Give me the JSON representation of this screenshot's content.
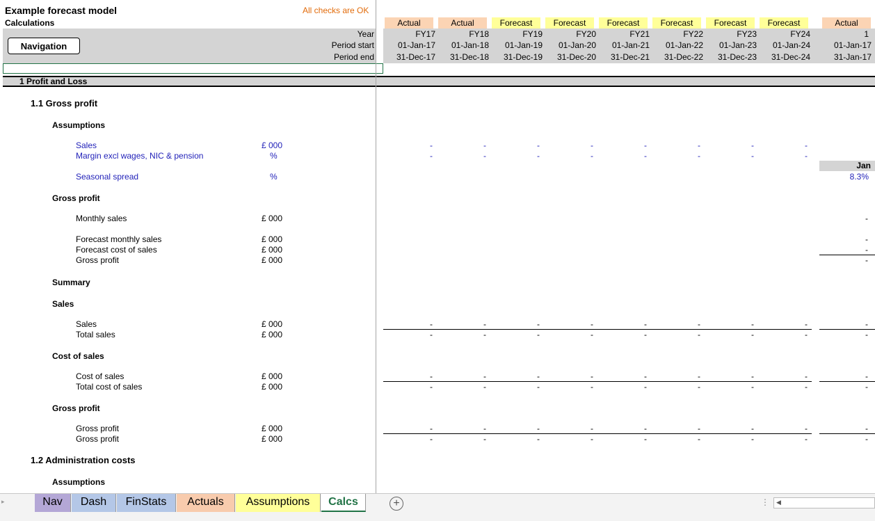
{
  "app": {
    "model_title": "Example forecast model",
    "sheet_subtitle": "Calculations",
    "checks_status": "All checks are OK",
    "nav_button": "Navigation"
  },
  "header_labels": {
    "year": "Year",
    "period_start": "Period start",
    "period_end": "Period end"
  },
  "columns": [
    {
      "type": "Actual",
      "year": "FY17",
      "start": "01-Jan-17",
      "end": "31-Dec-17"
    },
    {
      "type": "Actual",
      "year": "FY18",
      "start": "01-Jan-18",
      "end": "31-Dec-18"
    },
    {
      "type": "Forecast",
      "year": "FY19",
      "start": "01-Jan-19",
      "end": "31-Dec-19"
    },
    {
      "type": "Forecast",
      "year": "FY20",
      "start": "01-Jan-20",
      "end": "31-Dec-20"
    },
    {
      "type": "Forecast",
      "year": "FY21",
      "start": "01-Jan-21",
      "end": "31-Dec-21"
    },
    {
      "type": "Forecast",
      "year": "FY22",
      "start": "01-Jan-22",
      "end": "31-Dec-22"
    },
    {
      "type": "Forecast",
      "year": "FY23",
      "start": "01-Jan-23",
      "end": "31-Dec-23"
    },
    {
      "type": "Forecast",
      "year": "FY24",
      "start": "01-Jan-24",
      "end": "31-Dec-24"
    }
  ],
  "monthly_column": {
    "type": "Actual",
    "year": "1",
    "start": "01-Jan-17",
    "end": "31-Jan-17",
    "month_label": "Jan",
    "seasonal_value": "8.3%"
  },
  "sections": {
    "s1": "1 Profit and Loss",
    "s1_1": "1.1  Gross profit",
    "assumptions": "Assumptions",
    "gross_profit_hdr": "Gross profit",
    "summary": "Summary",
    "sales_hdr": "Sales",
    "cost_of_sales_hdr": "Cost of sales",
    "gross_profit_hdr2": "Gross profit",
    "s1_2": "1.2  Administration costs",
    "assumptions2": "Assumptions"
  },
  "rows": {
    "sales": {
      "label": "Sales",
      "unit": "£ 000"
    },
    "margin": {
      "label": "Margin excl wages, NIC & pension",
      "unit": "%"
    },
    "seasonal": {
      "label": "Seasonal spread",
      "unit": "%"
    },
    "monthly_sales": {
      "label": "Monthly sales",
      "unit": "£ 000"
    },
    "fc_monthly_sales": {
      "label": "Forecast monthly sales",
      "unit": "£ 000"
    },
    "fc_cost_sales": {
      "label": "Forecast cost of sales",
      "unit": "£ 000"
    },
    "gross_profit_row": {
      "label": "Gross profit",
      "unit": "£ 000"
    },
    "sum_sales": {
      "label": "Sales",
      "unit": "£ 000"
    },
    "total_sales": {
      "label": "Total sales",
      "unit": "£ 000"
    },
    "cost_sales": {
      "label": "Cost of sales",
      "unit": "£ 000"
    },
    "total_cost_sales": {
      "label": "Total cost of sales",
      "unit": "£ 000"
    },
    "gp1": {
      "label": "Gross profit",
      "unit": "£ 000"
    },
    "gp2": {
      "label": "Gross profit",
      "unit": "£ 000"
    }
  },
  "dash": "-",
  "tabs": [
    {
      "label": "Nav",
      "color": "#b4a7d6"
    },
    {
      "label": "Dash",
      "color": "#b4c7e7"
    },
    {
      "label": "FinStats",
      "color": "#b4c7e7"
    },
    {
      "label": "Actuals",
      "color": "#f8cbad"
    },
    {
      "label": "Assumptions",
      "color": "#ffff99"
    },
    {
      "label": "Calcs",
      "color": "#ffffff"
    }
  ],
  "add_sheet_icon": "plus-circle-icon"
}
